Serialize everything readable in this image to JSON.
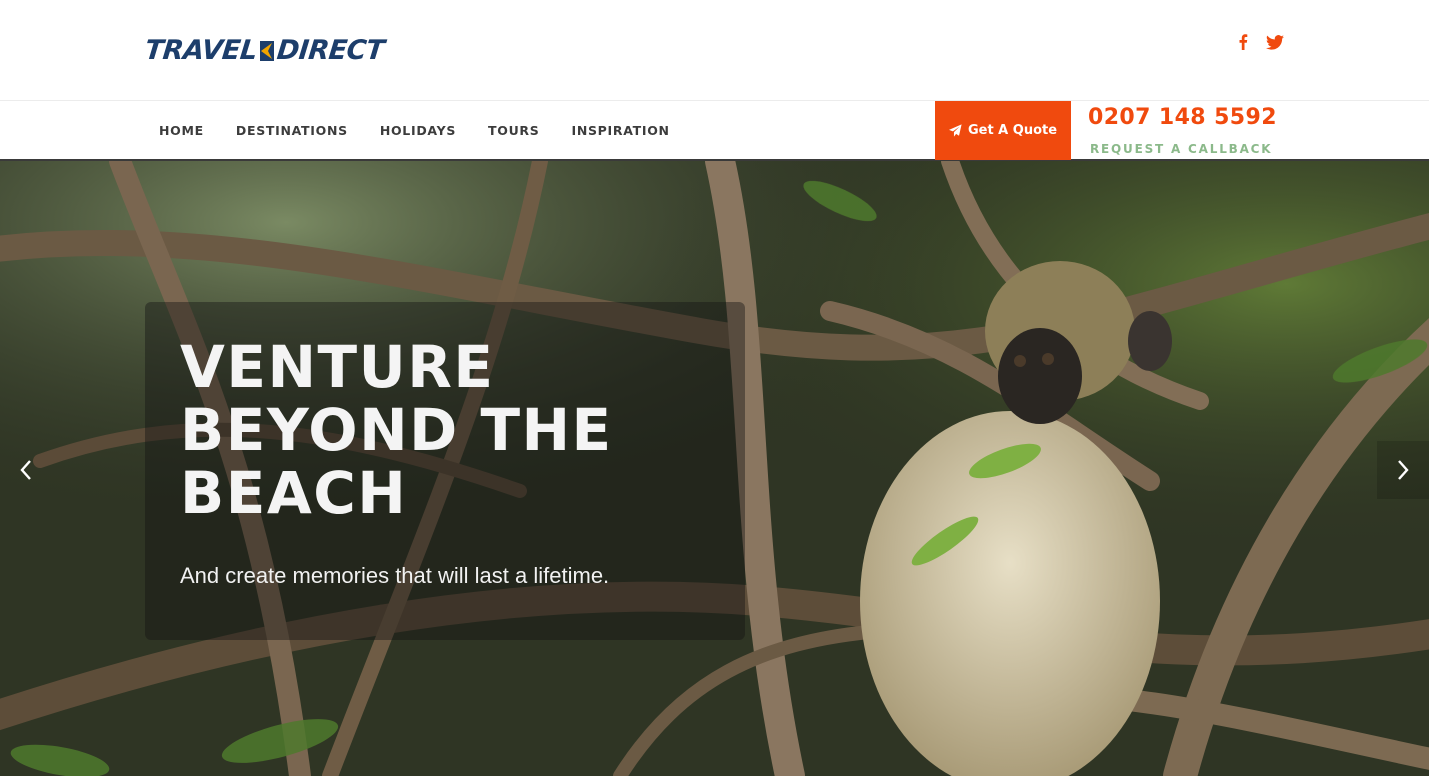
{
  "brand": {
    "logo_left": "TRAVEL",
    "logo_right": "DIRECT",
    "logo_color": "#1d3e6b",
    "accent": "#f04a0e"
  },
  "social": [
    {
      "icon": "facebook-icon"
    },
    {
      "icon": "twitter-icon"
    }
  ],
  "nav": {
    "items": [
      "HOME",
      "DESTINATIONS",
      "HOLIDAYS",
      "TOURS",
      "INSPIRATION"
    ]
  },
  "quote_button": {
    "label": "Get A Quote",
    "icon": "paper-plane-icon"
  },
  "contact": {
    "phone": "0207 148 5592",
    "callback_label": "REQUEST A CALLBACK",
    "callback_color": "#8bb98a"
  },
  "hero": {
    "headline": "VENTURE BEYOND THE BEACH",
    "subline": "And create memories that will last a lifetime.",
    "prev_icon": "chevron-left-icon",
    "next_icon": "chevron-right-icon"
  }
}
